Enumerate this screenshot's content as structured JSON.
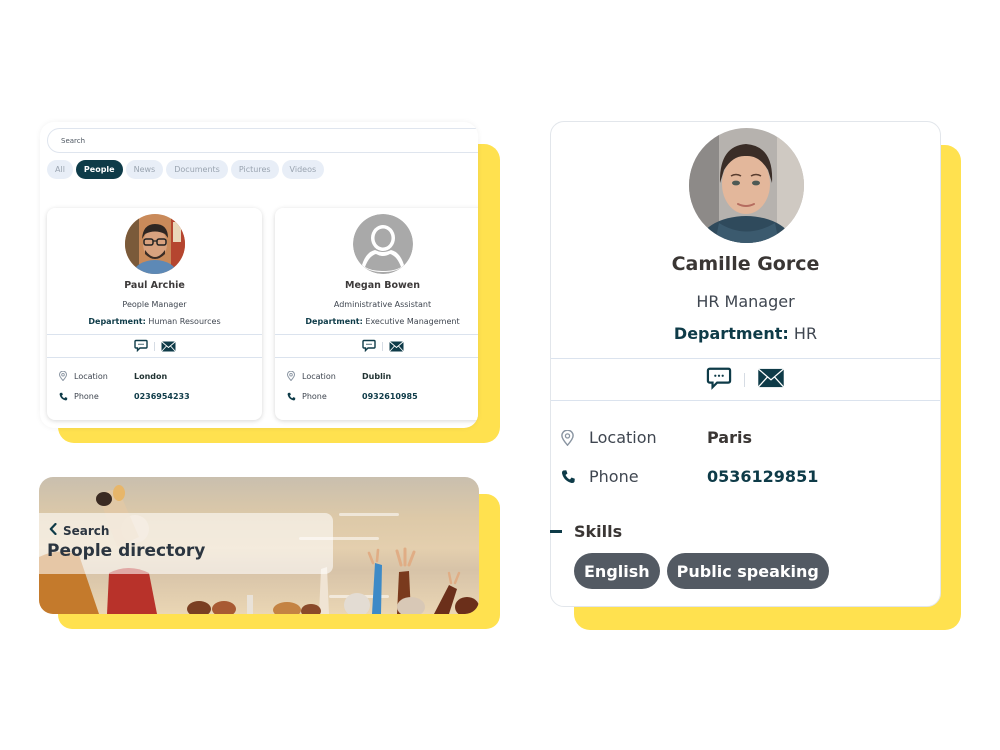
{
  "search": {
    "placeholder": "Search",
    "filters": [
      {
        "label": "All",
        "active": false
      },
      {
        "label": "People",
        "active": true
      },
      {
        "label": "News",
        "active": false
      },
      {
        "label": "Documents",
        "active": false
      },
      {
        "label": "Pictures",
        "active": false
      },
      {
        "label": "Videos",
        "active": false
      }
    ],
    "results": [
      {
        "name": "Paul Archie",
        "title": "People Manager",
        "department_label": "Department:",
        "department": "Human Resources",
        "location_label": "Location",
        "location": "London",
        "phone_label": "Phone",
        "phone": "0236954233"
      },
      {
        "name": "Megan Bowen",
        "title": "Administrative Assistant",
        "department_label": "Department:",
        "department": "Executive Management",
        "location_label": "Location",
        "location": "Dublin",
        "phone_label": "Phone",
        "phone": "0932610985"
      }
    ]
  },
  "banner": {
    "back_label": "Search",
    "title": "People directory"
  },
  "profile": {
    "name": "Camille Gorce",
    "title": "HR Manager",
    "department_label": "Department:",
    "department": "HR",
    "location_label": "Location",
    "location": "Paris",
    "phone_label": "Phone",
    "phone": "0536129851",
    "skills_label": "Skills",
    "skills": [
      "English",
      "Public speaking"
    ]
  },
  "colors": {
    "accent": "#0e3b48",
    "highlight": "#ffe14f",
    "chip_bg": "#e8eef7",
    "skill_tag": "#535a63"
  },
  "icons": {
    "chat": "chat-bubble-icon",
    "mail": "envelope-icon",
    "location": "map-pin-icon",
    "phone": "phone-icon",
    "back": "chevron-left-icon",
    "avatar_placeholder": "user-silhouette-icon"
  }
}
